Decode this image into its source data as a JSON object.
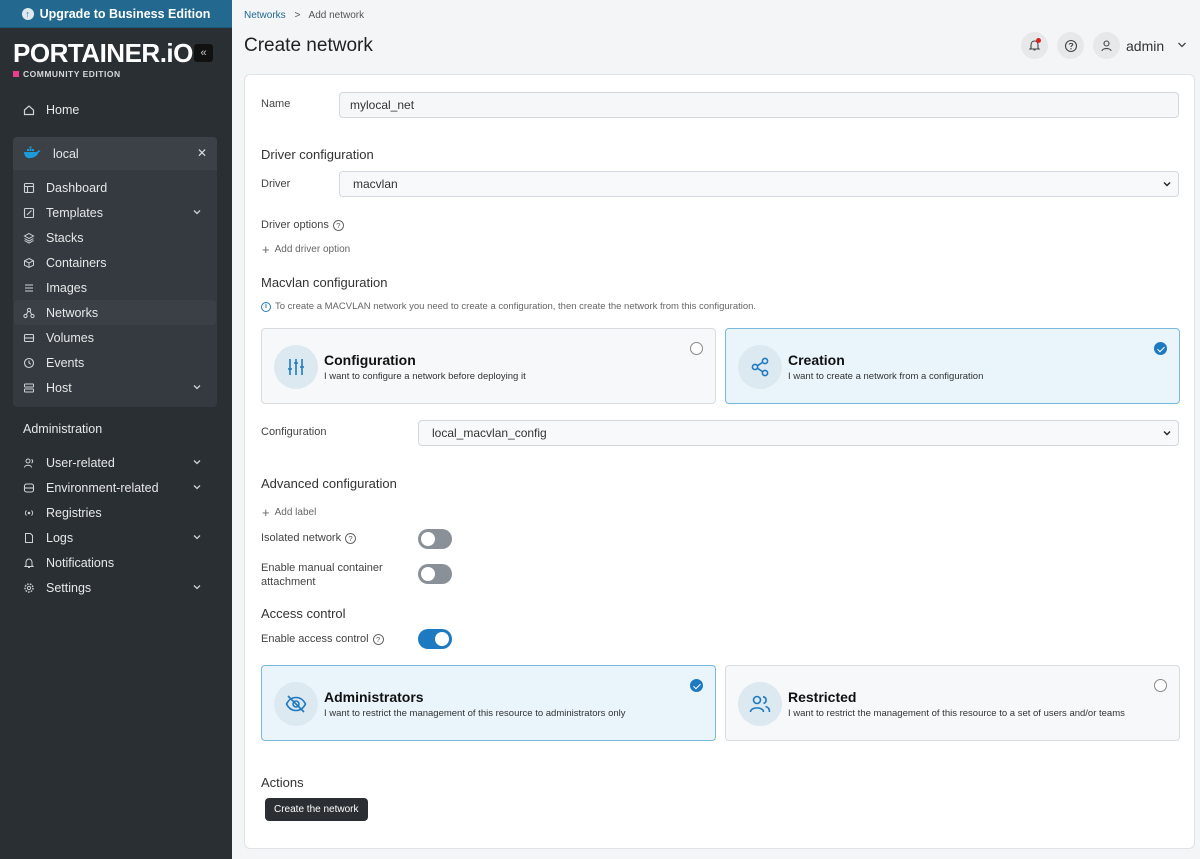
{
  "upgrade": {
    "label": "Upgrade to Business Edition"
  },
  "brand": {
    "logo": "PORTAINER.iO",
    "edition": "COMMUNITY EDITION"
  },
  "sidebar": {
    "home": "Home",
    "environment": {
      "name": "local"
    },
    "env_items": [
      {
        "label": "Dashboard",
        "icon": "dashboard-icon"
      },
      {
        "label": "Templates",
        "icon": "templates-icon"
      },
      {
        "label": "Stacks",
        "icon": "stacks-icon"
      },
      {
        "label": "Containers",
        "icon": "containers-icon"
      },
      {
        "label": "Images",
        "icon": "images-icon"
      },
      {
        "label": "Networks",
        "icon": "networks-icon"
      },
      {
        "label": "Volumes",
        "icon": "volumes-icon"
      },
      {
        "label": "Events",
        "icon": "events-icon"
      },
      {
        "label": "Host",
        "icon": "host-icon"
      }
    ],
    "admin_title": "Administration",
    "admin_items": [
      {
        "label": "User-related",
        "icon": "users-icon"
      },
      {
        "label": "Environment-related",
        "icon": "environment-icon"
      },
      {
        "label": "Registries",
        "icon": "registries-icon"
      },
      {
        "label": "Logs",
        "icon": "logs-icon"
      },
      {
        "label": "Notifications",
        "icon": "bell-icon"
      },
      {
        "label": "Settings",
        "icon": "gear-icon"
      }
    ]
  },
  "header": {
    "breadcrumb_root": "Networks",
    "breadcrumb_sep": ">",
    "breadcrumb_current": "Add network",
    "title": "Create network",
    "user": "admin"
  },
  "form": {
    "name_label": "Name",
    "name_value": "mylocal_net",
    "driver_section": "Driver configuration",
    "driver_label": "Driver",
    "driver_value": "macvlan",
    "driver_options_label": "Driver options",
    "add_driver_option": "Add driver option",
    "macvlan_section": "Macvlan configuration",
    "macvlan_info": "To create a MACVLAN network you need to create a configuration, then create the network from this configuration.",
    "macvlan_options": [
      {
        "title": "Configuration",
        "desc": "I want to configure a network before deploying it"
      },
      {
        "title": "Creation",
        "desc": "I want to create a network from a configuration"
      }
    ],
    "configuration_label": "Configuration",
    "configuration_value": "local_macvlan_config",
    "advanced_section": "Advanced configuration",
    "add_label": "Add label",
    "isolated_label": "Isolated network",
    "manual_attach_label": "Enable manual container attachment",
    "access_section": "Access control",
    "access_toggle_label": "Enable access control",
    "access_options": [
      {
        "title": "Administrators",
        "desc": "I want to restrict the management of this resource to administrators only"
      },
      {
        "title": "Restricted",
        "desc": "I want to restrict the management of this resource to a set of users and/or teams"
      }
    ],
    "actions_section": "Actions",
    "submit_label": "Create the network"
  },
  "colors": {
    "accent": "#1e7ac0",
    "sidebar_bg": "#2a2f33",
    "upgrade_bg": "#23698f"
  }
}
